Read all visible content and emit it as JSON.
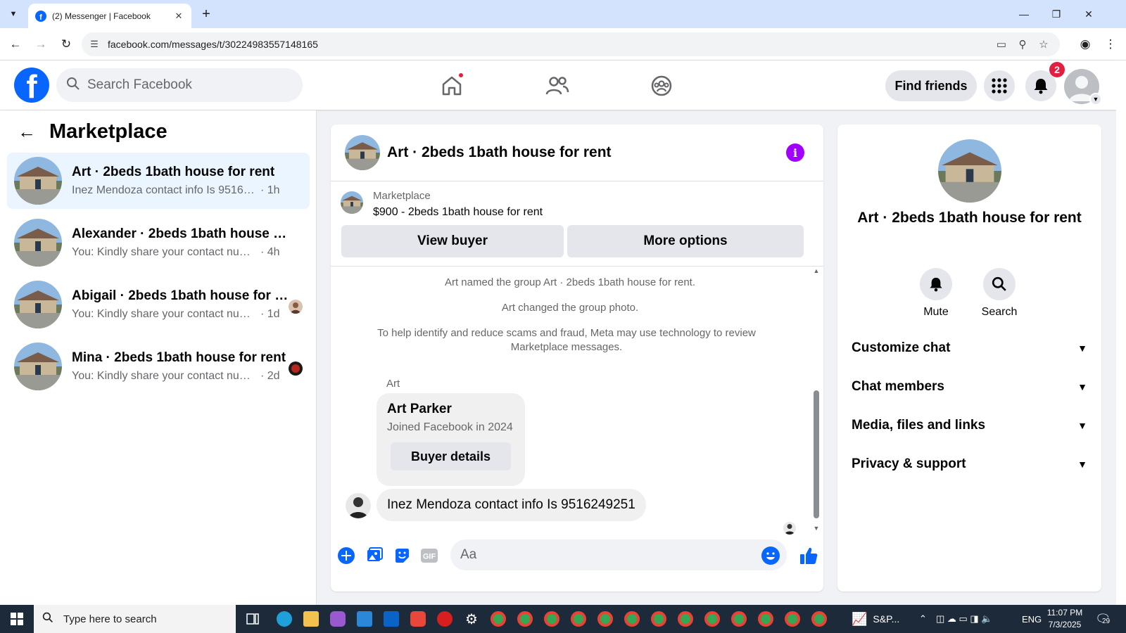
{
  "browser": {
    "tab_title": "(2) Messenger | Facebook",
    "url": "facebook.com/messages/t/30224983557148165"
  },
  "fb_header": {
    "search_placeholder": "Search Facebook",
    "find_friends_label": "Find friends",
    "notification_count": "2"
  },
  "sidebar": {
    "title": "Marketplace",
    "conversations": [
      {
        "name": "Art · 2beds 1bath house for rent",
        "snippet": "Inez Mendoza contact info Is 951624...",
        "time": "· 1h",
        "active": true
      },
      {
        "name": "Alexander · 2beds 1bath house for ...",
        "snippet": "You: Kindly share your contact numbe...",
        "time": "· 4h",
        "active": false
      },
      {
        "name": "Abigail · 2beds 1bath house for r...",
        "snippet": "You: Kindly share your contact num...",
        "time": "· 1d",
        "active": false
      },
      {
        "name": "Mina · 2beds 1bath house for rent",
        "snippet": "You: Kindly share your contact num...",
        "time": "· 2d",
        "active": false
      }
    ]
  },
  "chat": {
    "title": "Art · 2beds 1bath house for rent",
    "marketplace_label": "Marketplace",
    "listing": "$900 - 2beds 1bath house for rent",
    "view_buyer_label": "View buyer",
    "more_options_label": "More options",
    "system_messages": [
      "Art named the group Art · 2beds 1bath house for rent.",
      "Art changed the group photo.",
      "To help identify and reduce scams and fraud, Meta may use technology to review Marketplace messages."
    ],
    "sender_label": "Art",
    "card": {
      "name": "Art Parker",
      "subtitle": "Joined Facebook in 2024",
      "button_label": "Buyer details"
    },
    "message": "Inez Mendoza contact info Is 9516249251",
    "composer_placeholder": "Aa",
    "gif_label": "GIF"
  },
  "right_panel": {
    "title": "Art · 2beds 1bath house for rent",
    "mute_label": "Mute",
    "search_label": "Search",
    "sections": [
      "Customize chat",
      "Chat members",
      "Media, files and links",
      "Privacy & support"
    ]
  },
  "taskbar": {
    "search_placeholder": "Type here to search",
    "widget_label": "S&P...",
    "language": "ENG",
    "time": "11:07 PM",
    "date": "7/3/2025",
    "notification_count": "29"
  },
  "colors": {
    "facebook_blue": "#0866ff",
    "active_conversation_bg": "#ebf5ff",
    "info_purple": "#a100ff",
    "badge_red": "#e41e3f"
  }
}
